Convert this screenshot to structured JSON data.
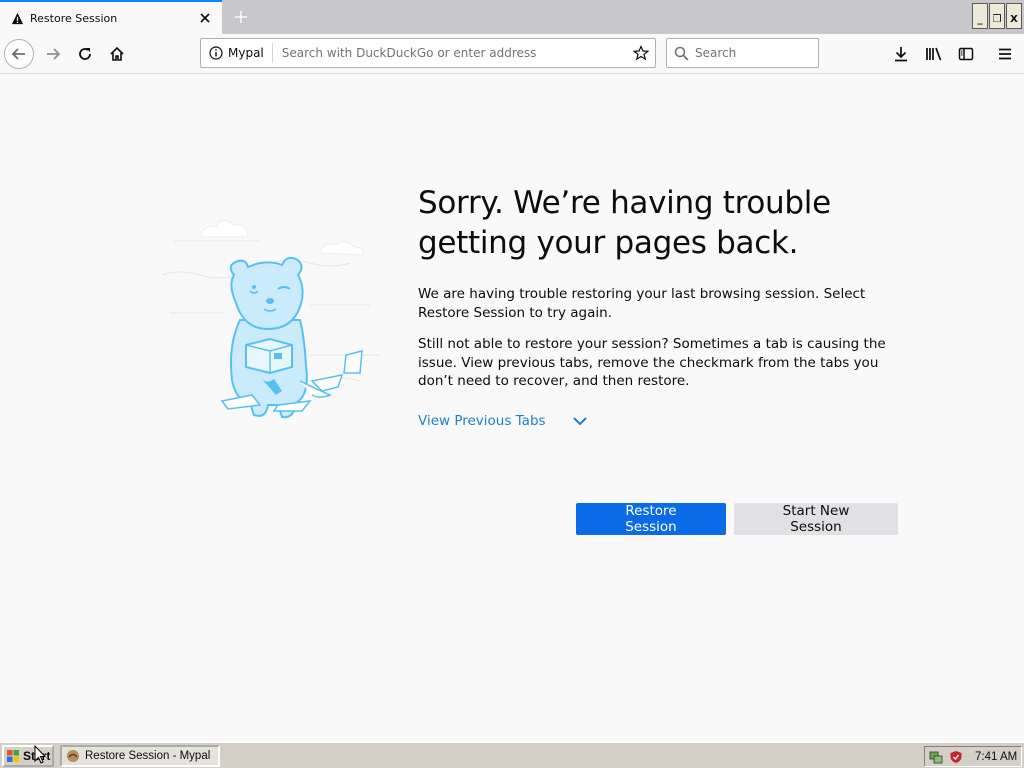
{
  "browser": {
    "tab": {
      "title": "Restore Session",
      "icon": "warning-icon"
    },
    "identity_label": "Mypal",
    "url_placeholder": "Search with DuckDuckGo or enter address",
    "search_placeholder": "Search",
    "window_controls": {
      "minimize": "_",
      "restore": "❐",
      "close": "X"
    }
  },
  "page": {
    "heading_line1": "Sorry. We’re having trouble",
    "heading_line2": "getting your pages back.",
    "para1": "We are having trouble restoring your last browsing session. Select Restore Session to try again.",
    "para2": "Still not able to restore your session? Sometimes a tab is causing the issue. View previous tabs, remove the checkmark from the tabs you don’t need to recover, and then restore.",
    "view_previous_tabs": "View Previous Tabs",
    "restore_button": "Restore Session",
    "new_session_button": "Start New Session",
    "accent_color": "#0a84ff"
  },
  "taskbar": {
    "start_label": "Start",
    "task_label": "Restore Session - Mypal",
    "time": "7:41 AM"
  }
}
